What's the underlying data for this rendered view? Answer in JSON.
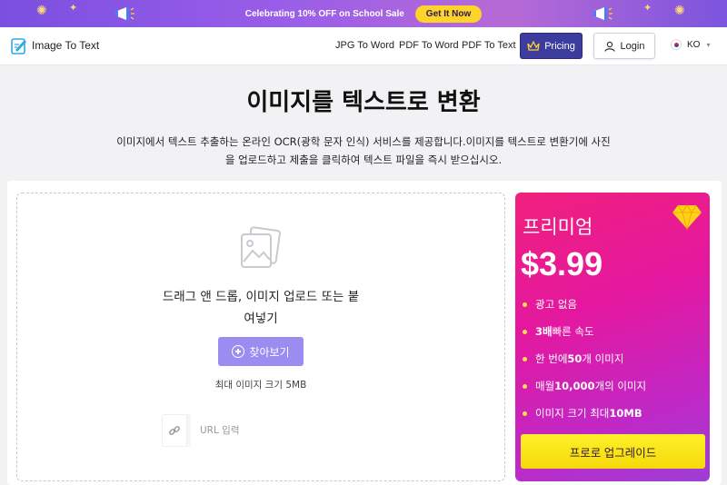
{
  "promo": {
    "text": "Celebrating 10% OFF on School Sale",
    "button": "Get It Now"
  },
  "header": {
    "logo_text": "Image To Text",
    "nav": [
      "JPG To Word",
      "PDF To Word",
      "PDF To Text"
    ],
    "pricing": "Pricing",
    "login": "Login",
    "language": "KO"
  },
  "hero": {
    "title": "이미지를 텍스트로 변환",
    "subtitle_line1": "이미지에서 텍스트 추출하는 온라인 OCR(광학 문자 인식) 서비스를 제공합니다.이미지를 텍스트로 변환기에 사진",
    "subtitle_line2": "을 업로드하고 제출을 클릭하여 텍스트 파일을 즉시 받으십시오."
  },
  "upload": {
    "drop_line1": "드래그 앤 드롭, 이미지 업로드 또는 붙",
    "drop_line2": "여넣기",
    "browse": "찾아보기",
    "max_size": "최대 이미지 크기 5MB",
    "url_placeholder": "URL 입력"
  },
  "premium": {
    "title": "프리미엄",
    "price": "$3.99",
    "features": [
      {
        "pre": "광고 없음",
        "bold": "",
        "post": ""
      },
      {
        "pre": "",
        "bold": "3배",
        "post": " 빠른 속도"
      },
      {
        "pre": "한 번에 ",
        "bold": "50",
        "post": "개 이미지"
      },
      {
        "pre": "매월 ",
        "bold": "10,000",
        "post": "개의 이미지"
      },
      {
        "pre": "이미지 크기 최대 ",
        "bold": "10MB",
        "post": ""
      }
    ],
    "upgrade": "프로로 업그레이드"
  },
  "colors": {
    "promo_bg": "#8a58e4",
    "accent_yellow": "#ffd42a",
    "pricing_bg": "#3c3c9e",
    "browse_bg": "#9b8cf2",
    "premium_pink": "#f0207c",
    "premium_purple": "#9d3fd6"
  },
  "icons": [
    "megaphone-icon",
    "firework-icon",
    "logo-icon",
    "crown-icon",
    "user-icon",
    "korea-flag-icon",
    "chevron-down-icon",
    "image-icon",
    "plus-circle-icon",
    "link-icon",
    "diamond-icon"
  ]
}
